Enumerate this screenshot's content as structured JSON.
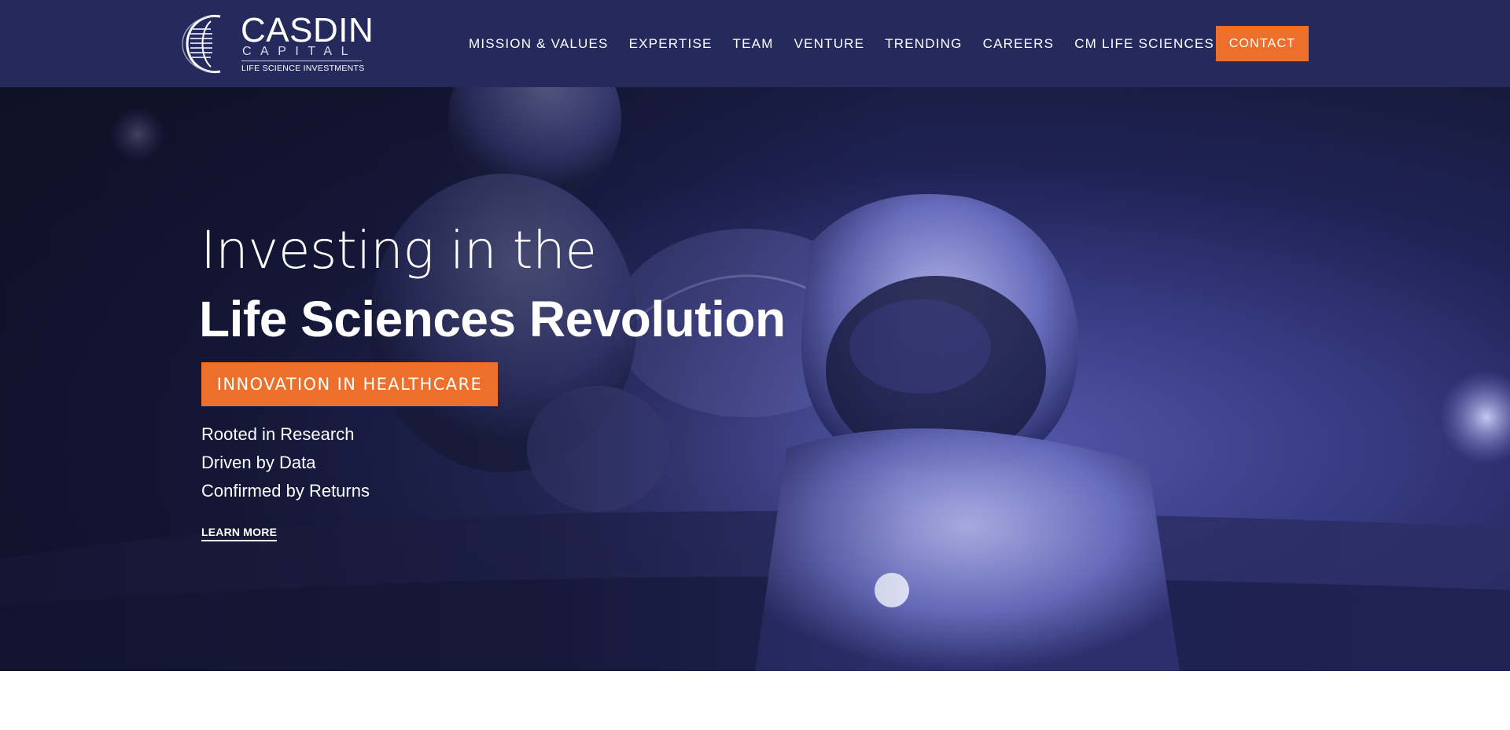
{
  "header": {
    "logo": {
      "name": "CASDIN",
      "sub": "CAPITAL",
      "tagline": "LIFE SCIENCE INVESTMENTS"
    },
    "nav": [
      {
        "label": "MISSION & VALUES"
      },
      {
        "label": "EXPERTISE"
      },
      {
        "label": "TEAM"
      },
      {
        "label": "VENTURE"
      },
      {
        "label": "TRENDING"
      },
      {
        "label": "CAREERS"
      },
      {
        "label": "CM LIFE SCIENCES"
      }
    ],
    "contact_label": "CONTACT"
  },
  "hero": {
    "line1": "Investing in the",
    "line2": "Life Sciences Revolution",
    "badge": "INNOVATION IN HEALTHCARE",
    "points": [
      "Rooted in Research",
      "Driven by Data",
      "Confirmed by Returns"
    ],
    "learn_more": "LEARN MORE",
    "background_image": "astronauts-on-planet-surface"
  },
  "colors": {
    "header_bg": "#252a5c",
    "accent": "#ec6f2c",
    "hero_tint": "#3b3f8a"
  }
}
